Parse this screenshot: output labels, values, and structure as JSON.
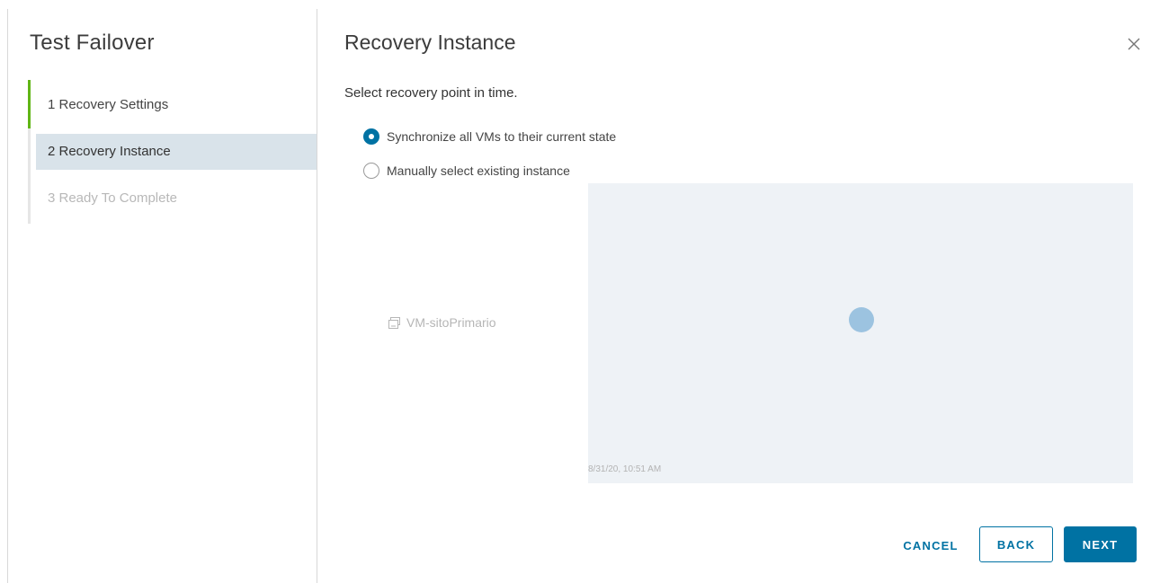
{
  "sidebar": {
    "title": "Test Failover",
    "steps": [
      {
        "label": "1 Recovery Settings",
        "state": "completed"
      },
      {
        "label": "2 Recovery Instance",
        "state": "active"
      },
      {
        "label": "3 Ready To Complete",
        "state": "disabled"
      }
    ]
  },
  "main": {
    "title": "Recovery Instance",
    "close_icon": "close-icon",
    "subtitle": "Select recovery point in time.",
    "options": [
      {
        "label": "Synchronize all VMs to their current state",
        "checked": true
      },
      {
        "label": "Manually select existing instance",
        "checked": false
      }
    ],
    "vm": {
      "name": "VM-sitoPrimario",
      "icon": "vm-icon"
    },
    "timeline": {
      "date_label": "8/31/20, 10:51 AM"
    }
  },
  "footer": {
    "cancel_label": "CANCEL",
    "back_label": "BACK",
    "next_label": "NEXT"
  },
  "colors": {
    "accent": "#0072a3",
    "completed_step": "#60b515",
    "active_step_bg": "#d9e3ea",
    "timeline_bg": "#eef2f6",
    "timeline_point": "#9cc3e0"
  }
}
